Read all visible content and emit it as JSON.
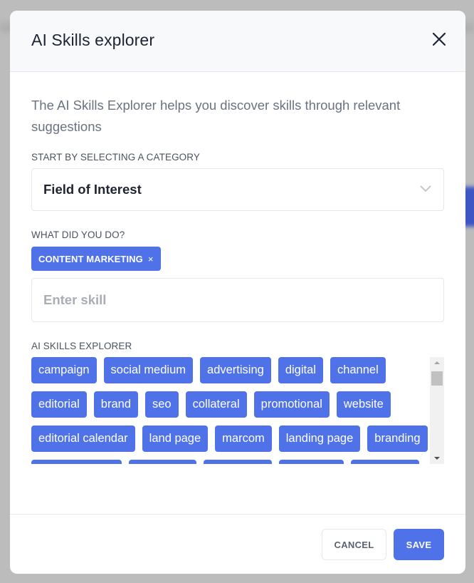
{
  "modal": {
    "title": "AI Skills explorer",
    "close_icon": "close-icon"
  },
  "intro": "The AI Skills Explorer helps you discover skills through relevant suggestions",
  "category": {
    "label": "START BY SELECTING A CATEGORY",
    "selected": "Field of Interest",
    "icon": "chevron-down-icon"
  },
  "what_did_you_do": {
    "label": "WHAT DID YOU DO?",
    "selected_chips": [
      {
        "label": "CONTENT MARKETING",
        "remove_glyph": "×"
      }
    ],
    "input_placeholder": "Enter skill",
    "input_value": ""
  },
  "ai_skills": {
    "label": "AI SKILLS EXPLORER",
    "suggestions": [
      "campaign",
      "social medium",
      "advertising",
      "digital",
      "channel",
      "editorial",
      "brand",
      "seo",
      "collateral",
      "promotional",
      "website",
      "editorial calendar",
      "land page",
      "marcom",
      "landing page",
      "branding"
    ]
  },
  "footer": {
    "cancel_label": "CANCEL",
    "save_label": "SAVE"
  },
  "colors": {
    "accent": "#4f72e8",
    "overlay": "#bcbcbc"
  }
}
